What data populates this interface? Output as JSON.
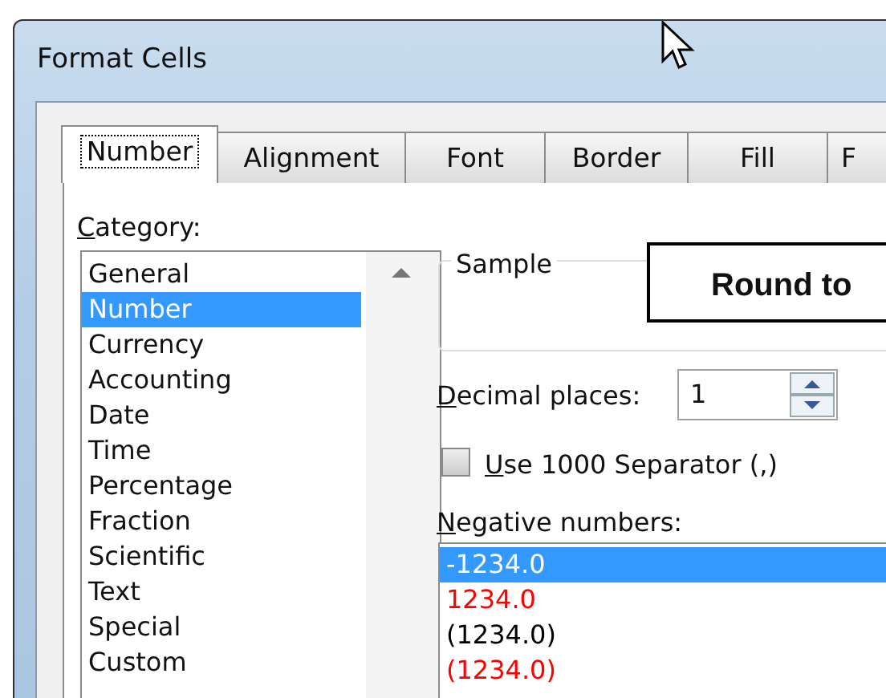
{
  "window": {
    "title": "Format Cells"
  },
  "tabs": [
    {
      "label": "Number",
      "selected": true
    },
    {
      "label": "Alignment",
      "selected": false
    },
    {
      "label": "Font",
      "selected": false
    },
    {
      "label": "Border",
      "selected": false
    },
    {
      "label": "Fill",
      "selected": false
    },
    {
      "label": "F",
      "selected": false
    }
  ],
  "category": {
    "label": "Category:",
    "items": [
      {
        "label": "General",
        "selected": false
      },
      {
        "label": "Number",
        "selected": true
      },
      {
        "label": "Currency",
        "selected": false
      },
      {
        "label": "Accounting",
        "selected": false
      },
      {
        "label": "Date",
        "selected": false
      },
      {
        "label": "Time",
        "selected": false
      },
      {
        "label": "Percentage",
        "selected": false
      },
      {
        "label": "Fraction",
        "selected": false
      },
      {
        "label": "Scientific",
        "selected": false
      },
      {
        "label": "Text",
        "selected": false
      },
      {
        "label": "Special",
        "selected": false
      },
      {
        "label": "Custom",
        "selected": false
      }
    ]
  },
  "sample": {
    "label": "Sample"
  },
  "callout": {
    "text": "Round to"
  },
  "decimal_places": {
    "label": "Decimal places:",
    "value": "1"
  },
  "separator": {
    "label": "Use 1000 Separator (,)",
    "checked": false
  },
  "negative_numbers": {
    "label": "Negative numbers:",
    "items": [
      {
        "label": "-1234.0",
        "selected": true
      },
      {
        "label": "1234.0",
        "color": "#ff0000",
        "selected": false
      },
      {
        "label": "(1234.0)",
        "color": "#000000",
        "selected": false
      },
      {
        "label": "(1234.0)",
        "color": "#ff0000",
        "selected": false
      }
    ]
  }
}
